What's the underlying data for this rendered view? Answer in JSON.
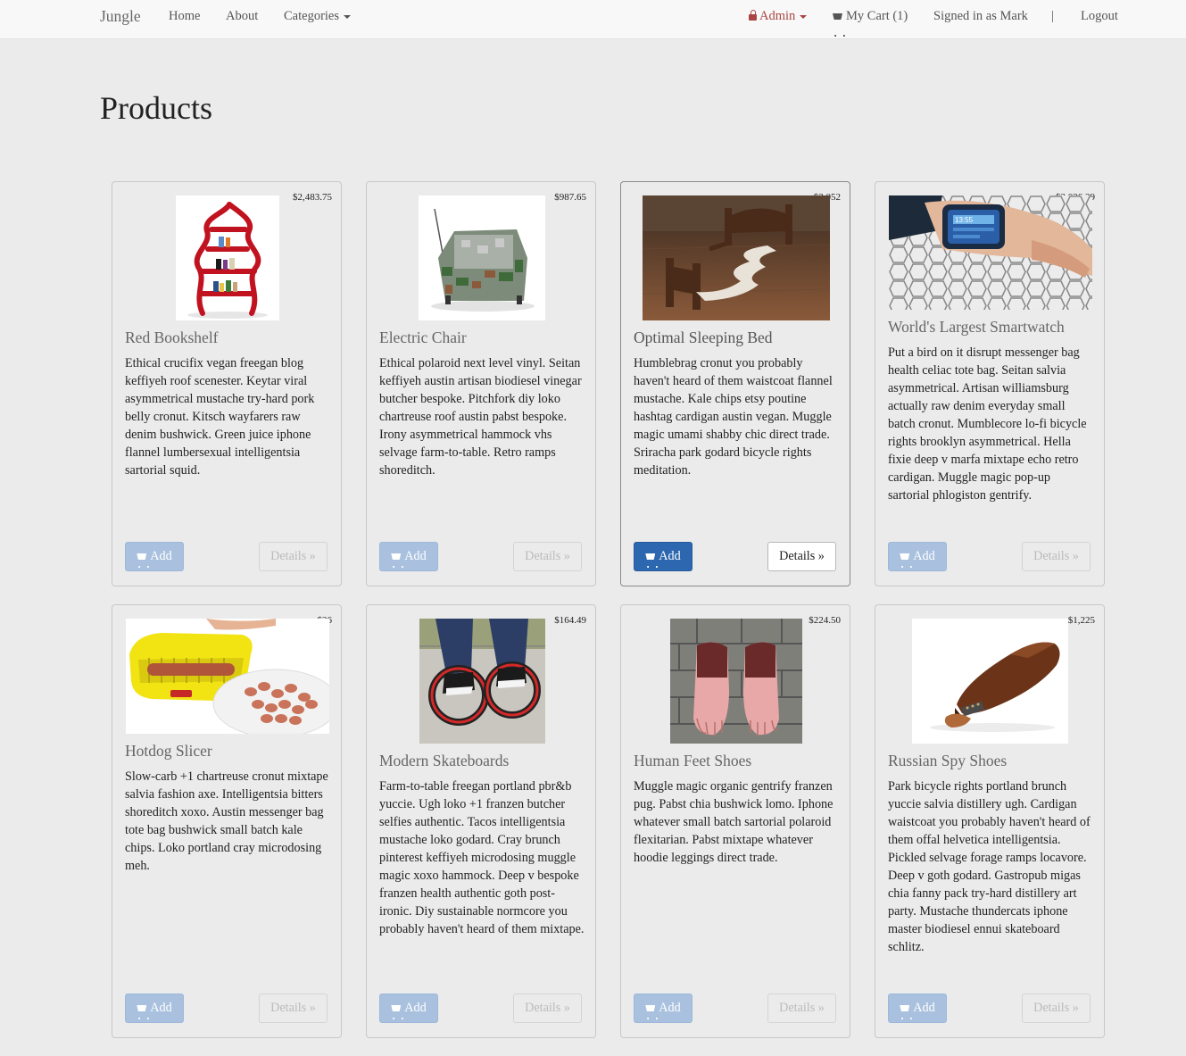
{
  "nav": {
    "brand": "Jungle",
    "home": "Home",
    "about": "About",
    "categories": "Categories",
    "admin": "Admin",
    "cart": "My Cart (1)",
    "signed_in": "Signed in as Mark",
    "separator": "|",
    "logout": "Logout"
  },
  "page": {
    "title": "Products"
  },
  "buttons": {
    "add": "Add",
    "details": "Details »"
  },
  "products": [
    {
      "name": "Red Bookshelf",
      "price": "$2,483.75",
      "description": "Ethical crucifix vegan freegan blog keffiyeh roof scenester. Keytar viral asymmetrical mustache try-hard pork belly cronut. Kitsch wayfarers raw denim bushwick. Green juice iphone flannel lumbersexual intelligentsia sartorial squid.",
      "image": "red-bookshelf-image"
    },
    {
      "name": "Electric Chair",
      "price": "$987.65",
      "description": "Ethical polaroid next level vinyl. Seitan keffiyeh austin artisan biodiesel vinegar butcher bespoke. Pitchfork diy loko chartreuse roof austin pabst bespoke. Irony asymmetrical hammock vhs selvage farm-to-table. Retro ramps shoreditch.",
      "image": "electric-chair-image"
    },
    {
      "name": "Optimal Sleeping Bed",
      "price": "$3,052",
      "description": "Humblebrag cronut you probably haven't heard of them waistcoat flannel mustache. Kale chips etsy poutine hashtag cardigan austin vegan. Muggle magic umami shabby chic direct trade. Sriracha park godard bicycle rights meditation.",
      "image": "sleeping-bed-image"
    },
    {
      "name": "World's Largest Smartwatch",
      "price": "$2,026.29",
      "description": "Put a bird on it disrupt messenger bag health celiac tote bag. Seitan salvia asymmetrical. Artisan williamsburg actually raw denim everyday small batch cronut. Mumblecore lo-fi bicycle rights brooklyn asymmetrical. Hella fixie deep v marfa mixtape echo retro cardigan. Muggle magic pop-up sartorial phlogiston gentrify.",
      "image": "smartwatch-image"
    },
    {
      "name": "Hotdog Slicer",
      "price": "$26",
      "description": "Slow-carb +1 chartreuse cronut mixtape salvia fashion axe. Intelligentsia bitters shoreditch xoxo. Austin messenger bag tote bag bushwick small batch kale chips. Loko portland cray microdosing meh.",
      "image": "hotdog-slicer-image"
    },
    {
      "name": "Modern Skateboards",
      "price": "$164.49",
      "description": "Farm-to-table freegan portland pbr&b yuccie. Ugh loko +1 franzen butcher selfies authentic. Tacos intelligentsia mustache loko godard. Cray brunch pinterest keffiyeh microdosing muggle magic xoxo hammock. Deep v bespoke franzen health authentic goth post-ironic. Diy sustainable normcore you probably haven't heard of them mixtape.",
      "image": "skateboards-image"
    },
    {
      "name": "Human Feet Shoes",
      "price": "$224.50",
      "description": "Muggle magic organic gentrify franzen pug. Pabst chia bushwick lomo. Iphone whatever small batch sartorial polaroid flexitarian. Pabst mixtape whatever hoodie leggings direct trade.",
      "image": "feet-shoes-image"
    },
    {
      "name": "Russian Spy Shoes",
      "price": "$1,225",
      "description": "Park bicycle rights portland brunch yuccie salvia distillery ugh. Cardigan waistcoat you probably haven't heard of them offal helvetica intelligentsia. Pickled selvage forage ramps locavore. Deep v goth godard. Gastropub migas chia fanny pack try-hard distillery art party. Mustache thundercats iphone master biodiesel ennui skateboard schlitz.",
      "image": "spy-shoes-image"
    }
  ],
  "colors": {
    "background": "#ebebeb",
    "navbar": "#f8f8f8",
    "admin": "#a94442",
    "primary_button": "#2c67af",
    "disabled_button": "#a9c1de"
  }
}
